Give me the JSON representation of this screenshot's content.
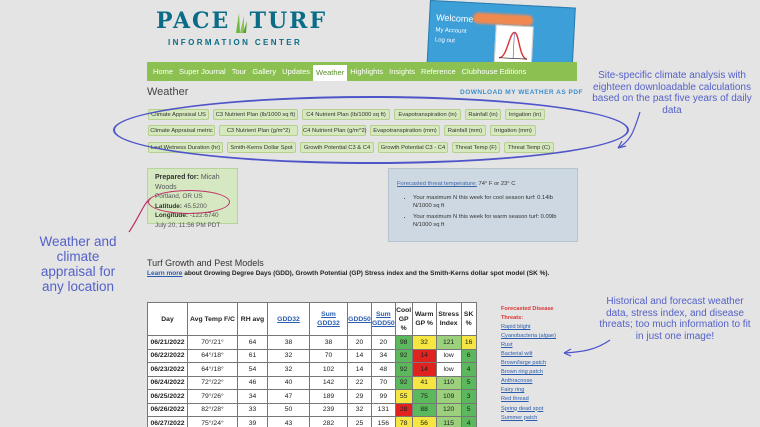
{
  "logo": {
    "brand_left": "PACE",
    "brand_right": "TURF",
    "subtitle": "INFORMATION CENTER"
  },
  "welcome": {
    "text": "Welcome",
    "my_account": "My Account",
    "log_out": "Log out"
  },
  "nav": {
    "items": [
      "Home",
      "Super Journal",
      "Tour",
      "Gallery",
      "Updates",
      "Weather",
      "Highlights",
      "Insights",
      "Reference",
      "Clubhouse Editions"
    ],
    "active": "Weather"
  },
  "weather": {
    "title": "Weather",
    "download_label": "DOWNLOAD MY WEATHER AS PDF"
  },
  "buttons": {
    "row1": [
      "Climate Appraisal US",
      "C3 Nutrient Plan (lb/1000 sq ft)",
      "C4 Nutrient Plan (lb/1000 sq ft)",
      "Evapotranspiration (in)",
      "Rainfall (in)",
      "Irrigation (in)"
    ],
    "row2": [
      "Climate Appraisal metric",
      "C3 Nutrient Plan (g/m^2)",
      "C4 Nutrient Plan (g/m^2)",
      "Evapotranspiration (mm)",
      "Rainfall (mm)",
      "Irrigation (mm)"
    ],
    "row3": [
      "Leaf Wetness Duration (hr)",
      "Smith-Kerns Dollar Spot",
      "Growth Potential C3 & C4",
      "Growth Potential C3 - C4",
      "Threat Temp (F)",
      "Threat Temp (C)"
    ]
  },
  "prepared": {
    "label": "Prepared for:",
    "name": "Micah Woods",
    "location": "Portland, OR US",
    "latitude_label": "Latitude:",
    "latitude": "45.5200",
    "longitude_label": "Longitude:",
    "longitude": "-122.6740",
    "timestamp": "July 20, 11:56 PM PDT"
  },
  "forecast": {
    "link": "Forecasted threat temperature:",
    "temp": "74° F or 23° C",
    "bullets": [
      "Your maximum N this week for cool season turf: 0.14lb N/1000 sq ft",
      "Your maximum N this week for warm season turf: 0.09lb N/1000 sq ft"
    ]
  },
  "turf": {
    "title": "Turf Growth and Pest Models",
    "learn_more": "Learn more",
    "desc": " about Growing Degree Days (GDD), Growth Potential (GP) Stress index and the Smith-Kerns dollar spot model (SK %)."
  },
  "table": {
    "headers": [
      "Day",
      "Avg Temp F/C",
      "RH avg",
      "GDD32",
      "Sum GDD32",
      "GDD50",
      "Sum GDD50",
      "Cool GP %",
      "Warm GP %",
      "Stress Index",
      "SK %"
    ],
    "rows": [
      [
        "06/21/2022",
        "70°/21°",
        "64",
        "38",
        "38",
        "20",
        "20",
        "98",
        "32",
        "121",
        "16"
      ],
      [
        "06/22/2022",
        "64°/18°",
        "61",
        "32",
        "70",
        "14",
        "34",
        "92",
        "14",
        "low",
        "6"
      ],
      [
        "06/23/2022",
        "64°/18°",
        "54",
        "32",
        "102",
        "14",
        "48",
        "92",
        "14",
        "low",
        "4"
      ],
      [
        "06/24/2022",
        "72°/22°",
        "46",
        "40",
        "142",
        "22",
        "70",
        "92",
        "41",
        "110",
        "5"
      ],
      [
        "06/25/2022",
        "79°/26°",
        "34",
        "47",
        "189",
        "29",
        "99",
        "55",
        "75",
        "109",
        "3"
      ],
      [
        "06/26/2022",
        "82°/28°",
        "33",
        "50",
        "239",
        "32",
        "131",
        "28",
        "88",
        "120",
        "5"
      ],
      [
        "06/27/2022",
        "75°/24°",
        "39",
        "43",
        "282",
        "25",
        "156",
        "78",
        "56",
        "115",
        "4"
      ]
    ],
    "cell_colors": [
      [
        "g",
        "y",
        "lg",
        "y"
      ],
      [
        "g",
        "r",
        "",
        "g"
      ],
      [
        "g",
        "r",
        "",
        "g"
      ],
      [
        "g",
        "y",
        "lg",
        "g"
      ],
      [
        "y",
        "g",
        "lg",
        "g"
      ],
      [
        "r",
        "g",
        "lg",
        "g"
      ],
      [
        "y",
        "y",
        "lg",
        "g"
      ]
    ]
  },
  "threats": {
    "header": "Forecasted Disease Threats:",
    "items": [
      "Rapid blight",
      "Cyanobacteria (algae)",
      "Rust",
      "Bacterial wilt",
      "Brown/large patch",
      "Brown ring patch",
      "Anthracnose",
      "Fairy ring",
      "Red thread",
      "Spring dead spot",
      "Summer patch"
    ]
  },
  "annotations": {
    "top_right": "Site-specific climate analysis with eighteen downloadable calculations based on the past five years of daily data",
    "left": "Weather and climate appraisal for any location",
    "bottom_right": "Historical and forecast weather data, stress index, and disease threats; too much information to fit in just one image!"
  },
  "colors": {
    "nav": "#8cc152",
    "button_bg": "#d6e8bd",
    "annotation": "#5461c8",
    "ellipse": "#4e55c8",
    "pink_circle": "#c0306a",
    "brand": "#0b6c87"
  }
}
